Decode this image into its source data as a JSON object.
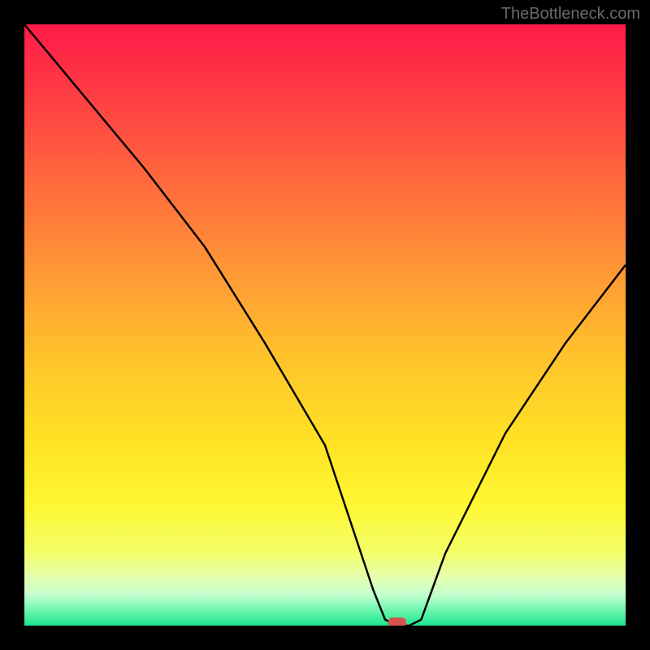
{
  "attribution": "TheBottleneck.com",
  "chart_data": {
    "type": "line",
    "title": "",
    "xlabel": "",
    "ylabel": "",
    "xlim": [
      0,
      100
    ],
    "ylim": [
      0,
      100
    ],
    "grid": false,
    "legend": false,
    "marker": {
      "x": 62,
      "y": 0,
      "color": "#d9534f"
    },
    "series": [
      {
        "name": "bottleneck-curve",
        "x": [
          0,
          10,
          20,
          30,
          40,
          50,
          58,
          60,
          62,
          64,
          66,
          70,
          80,
          90,
          100
        ],
        "values": [
          100,
          88,
          76,
          63,
          47,
          30,
          6,
          1,
          0,
          0,
          1,
          12,
          32,
          47,
          60
        ]
      }
    ],
    "background_gradient": {
      "stops": [
        {
          "offset": 0.0,
          "color": "#ff1a49"
        },
        {
          "offset": 0.2,
          "color": "#ff5640"
        },
        {
          "offset": 0.4,
          "color": "#ff9436"
        },
        {
          "offset": 0.55,
          "color": "#ffc22c"
        },
        {
          "offset": 0.7,
          "color": "#ffe324"
        },
        {
          "offset": 0.8,
          "color": "#fff733"
        },
        {
          "offset": 0.88,
          "color": "#f2ff6a"
        },
        {
          "offset": 0.92,
          "color": "#e5ffb0"
        },
        {
          "offset": 0.95,
          "color": "#c0ffcf"
        },
        {
          "offset": 0.97,
          "color": "#7cf7b3"
        },
        {
          "offset": 1.0,
          "color": "#1ce692"
        }
      ]
    }
  }
}
